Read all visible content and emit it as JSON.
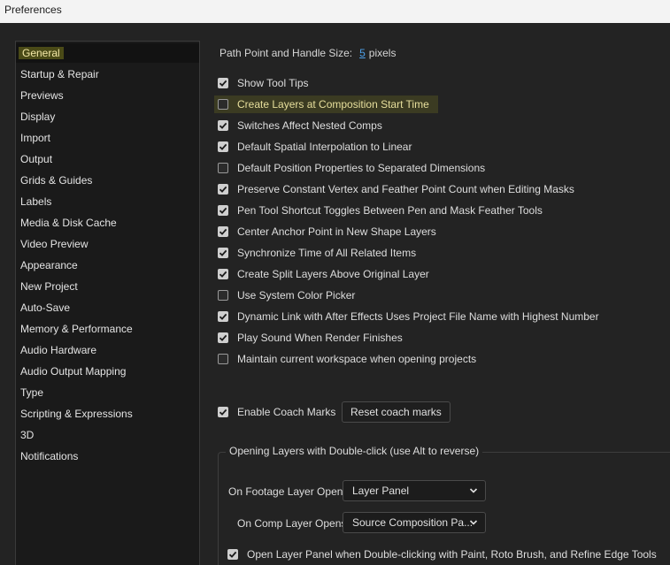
{
  "window": {
    "title": "Preferences"
  },
  "sidebar": {
    "items": [
      {
        "label": "General",
        "active": true
      },
      {
        "label": "Startup & Repair"
      },
      {
        "label": "Previews"
      },
      {
        "label": "Display"
      },
      {
        "label": "Import"
      },
      {
        "label": "Output"
      },
      {
        "label": "Grids & Guides"
      },
      {
        "label": "Labels"
      },
      {
        "label": "Media & Disk Cache"
      },
      {
        "label": "Video Preview"
      },
      {
        "label": "Appearance"
      },
      {
        "label": "New Project"
      },
      {
        "label": "Auto-Save"
      },
      {
        "label": "Memory & Performance"
      },
      {
        "label": "Audio Hardware"
      },
      {
        "label": "Audio Output Mapping"
      },
      {
        "label": "Type"
      },
      {
        "label": "Scripting & Expressions"
      },
      {
        "label": "3D"
      },
      {
        "label": "Notifications"
      }
    ]
  },
  "general": {
    "path_point_label": "Path Point and Handle Size:",
    "path_point_value": "5",
    "path_point_unit": "pixels",
    "options": [
      {
        "label": "Show Tool Tips",
        "checked": true
      },
      {
        "label": "Create Layers at Composition Start Time",
        "checked": false,
        "highlighted": true
      },
      {
        "label": "Switches Affect Nested Comps",
        "checked": true
      },
      {
        "label": "Default Spatial Interpolation to Linear",
        "checked": true
      },
      {
        "label": "Default Position Properties to Separated Dimensions",
        "checked": false
      },
      {
        "label": "Preserve Constant Vertex and Feather Point Count when Editing Masks",
        "checked": true
      },
      {
        "label": "Pen Tool Shortcut Toggles Between Pen and Mask Feather Tools",
        "checked": true
      },
      {
        "label": "Center Anchor Point in New Shape Layers",
        "checked": true
      },
      {
        "label": "Synchronize Time of All Related Items",
        "checked": true
      },
      {
        "label": "Create Split Layers Above Original Layer",
        "checked": true
      },
      {
        "label": "Use System Color Picker",
        "checked": false
      },
      {
        "label": "Dynamic Link with After Effects Uses Project File Name with Highest Number",
        "checked": true
      },
      {
        "label": "Play Sound When Render Finishes",
        "checked": true
      },
      {
        "label": "Maintain current workspace when opening projects",
        "checked": false
      }
    ],
    "coach_marks": {
      "label": "Enable Coach Marks",
      "checked": true
    },
    "reset_coach_label": "Reset coach marks",
    "double_click_group": {
      "legend": "Opening Layers with Double-click (use Alt to reverse)",
      "footage_label": "On Footage Layer Opens:",
      "footage_value": "Layer Panel",
      "comp_label": "On Comp Layer Opens:",
      "comp_value": "Source Composition Pa...",
      "open_layer_panel": {
        "label": "Open Layer Panel when Double-clicking with Paint, Roto Brush, and Refine Edge Tools",
        "checked": true
      }
    }
  }
}
